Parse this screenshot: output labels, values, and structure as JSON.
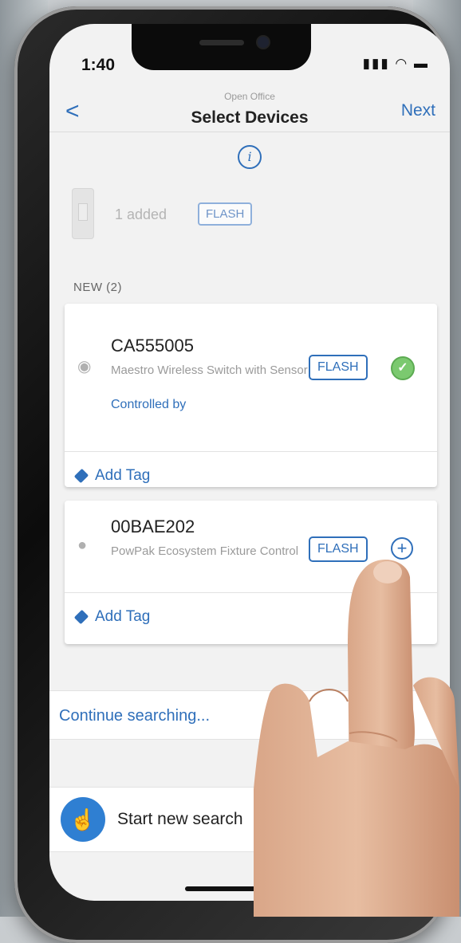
{
  "status": {
    "time": "1:40",
    "icons": "signal-wifi-battery"
  },
  "nav": {
    "back": "<",
    "subtitle": "Open Office",
    "title": "Select Devices",
    "next": "Next"
  },
  "added": {
    "text": "1 added",
    "flash": "FLASH"
  },
  "section": {
    "header": "NEW (2)"
  },
  "devices": [
    {
      "id": "CA555005",
      "description": "Maestro Wireless Switch with Sensor",
      "controlled_by": "Controlled by",
      "flash": "FLASH",
      "status_icon": "check-icon",
      "add_tag": "Add Tag"
    },
    {
      "id": "00BAE202",
      "description": "PowPak Ecosystem Fixture Control",
      "flash": "FLASH",
      "status_icon": "plus-icon",
      "add_tag": "Add Tag"
    }
  ],
  "actions": {
    "continue": "Continue searching...",
    "new_search": "Start new search"
  },
  "colors": {
    "accent": "#2f6fba",
    "check": "#7bc96f",
    "search_button": "#2f7fd2"
  }
}
